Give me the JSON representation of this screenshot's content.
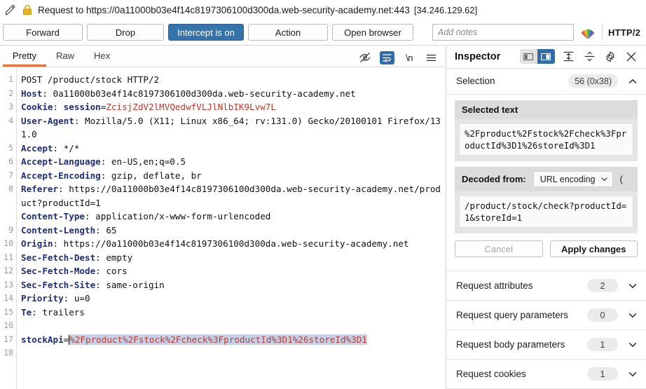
{
  "titlebar": {
    "edit_icon": "pencil-icon",
    "lock_icon": "lock-icon",
    "text": "Request to https://0a11000b03e4f14c8197306100d300da.web-security-academy.net:443",
    "ip": "[34.246.129.62]"
  },
  "actionbar": {
    "forward": "Forward",
    "drop": "Drop",
    "intercept": "Intercept is on",
    "action": "Action",
    "open_browser": "Open browser",
    "notes_placeholder": "Add notes",
    "notes_value": "",
    "logo_icon": "burp-logo-icon",
    "http_version": "HTTP/2",
    "accent_blue": "#3573ab"
  },
  "viewtabs": {
    "tabs": [
      {
        "label": "Pretty",
        "active": true
      },
      {
        "label": "Raw",
        "active": false
      },
      {
        "label": "Hex",
        "active": false
      }
    ],
    "active_underline_color": "#e8703a",
    "icons": [
      {
        "name": "eye-slash-icon",
        "active": false
      },
      {
        "name": "word-wrap-icon",
        "active": true
      },
      {
        "name": "show-newlines-icon",
        "active": false,
        "glyph": "\\n"
      },
      {
        "name": "hamburger-menu-icon",
        "active": false
      }
    ]
  },
  "request": {
    "line_numbers": [
      "1",
      "2",
      "3",
      "4",
      "",
      "5",
      "6",
      "7",
      "8",
      "",
      "",
      "9",
      "10",
      "11",
      "12",
      "13",
      "14",
      "15",
      "16",
      "17",
      "18"
    ],
    "lines": [
      {
        "n": 1,
        "parts": [
          {
            "t": "POST /product/stock HTTP/2",
            "c": "val"
          }
        ]
      },
      {
        "n": 2,
        "parts": [
          {
            "t": "Host",
            "c": "hdr"
          },
          {
            "t": ": 0a11000b03e4f14c8197306100d300da.web-security-academy.net",
            "c": "val"
          }
        ]
      },
      {
        "n": 3,
        "parts": [
          {
            "t": "Cookie",
            "c": "hdr"
          },
          {
            "t": ": ",
            "c": "val"
          },
          {
            "t": "session",
            "c": "hdr"
          },
          {
            "t": "=",
            "c": "val"
          },
          {
            "t": "ZcisjZdV2lMVQedwfVLJlNlbIK9Lvw7L",
            "c": "red"
          }
        ]
      },
      {
        "n": 4,
        "parts": [
          {
            "t": "User-Agent",
            "c": "hdr"
          },
          {
            "t": ": Mozilla/5.0 (X11; Linux x86_64; rv:131.0) Gecko/20100101 Firefox/131.0",
            "c": "val"
          }
        ]
      },
      {
        "n": 5,
        "parts": [
          {
            "t": "Accept",
            "c": "hdr"
          },
          {
            "t": ": */*",
            "c": "val"
          }
        ]
      },
      {
        "n": 6,
        "parts": [
          {
            "t": "Accept-Language",
            "c": "hdr"
          },
          {
            "t": ": en-US,en;q=0.5",
            "c": "val"
          }
        ]
      },
      {
        "n": 7,
        "parts": [
          {
            "t": "Accept-Encoding",
            "c": "hdr"
          },
          {
            "t": ": gzip, deflate, br",
            "c": "val"
          }
        ]
      },
      {
        "n": 8,
        "parts": [
          {
            "t": "Referer",
            "c": "hdr"
          },
          {
            "t": ": https://0a11000b03e4f14c8197306100d300da.web-security-academy.net/product?productId=1",
            "c": "val"
          }
        ]
      },
      {
        "n": 9,
        "parts": [
          {
            "t": "Content-Type",
            "c": "hdr"
          },
          {
            "t": ": application/x-www-form-urlencoded",
            "c": "val"
          }
        ]
      },
      {
        "n": 10,
        "parts": [
          {
            "t": "Content-Length",
            "c": "hdr"
          },
          {
            "t": ": 65",
            "c": "val"
          }
        ]
      },
      {
        "n": 11,
        "parts": [
          {
            "t": "Origin",
            "c": "hdr"
          },
          {
            "t": ": https://0a11000b03e4f14c8197306100d300da.web-security-academy.net",
            "c": "val"
          }
        ]
      },
      {
        "n": 12,
        "parts": [
          {
            "t": "Sec-Fetch-Dest",
            "c": "hdr"
          },
          {
            "t": ": empty",
            "c": "val"
          }
        ]
      },
      {
        "n": 13,
        "parts": [
          {
            "t": "Sec-Fetch-Mode",
            "c": "hdr"
          },
          {
            "t": ": cors",
            "c": "val"
          }
        ]
      },
      {
        "n": 14,
        "parts": [
          {
            "t": "Sec-Fetch-Site",
            "c": "hdr"
          },
          {
            "t": ": same-origin",
            "c": "val"
          }
        ]
      },
      {
        "n": 15,
        "parts": [
          {
            "t": "Priority",
            "c": "hdr"
          },
          {
            "t": ": u=0",
            "c": "val"
          }
        ]
      },
      {
        "n": 16,
        "parts": [
          {
            "t": "Te",
            "c": "hdr"
          },
          {
            "t": ": trailers",
            "c": "val"
          }
        ]
      },
      {
        "n": 17,
        "parts": [
          {
            "t": "",
            "c": "val"
          }
        ]
      },
      {
        "n": 18,
        "parts": [
          {
            "t": "stockApi",
            "c": "hdr"
          },
          {
            "t": "=",
            "c": "val"
          },
          {
            "t": "%2Fproduct%2Fstock%2Fcheck%3FproductId%3D1%26storeId%3D1",
            "c": "red sel"
          }
        ]
      }
    ],
    "selection_highlight_color": "#bfd3ec"
  },
  "inspector": {
    "title": "Inspector",
    "tools": [
      {
        "name": "layout-left-icon",
        "active": false
      },
      {
        "name": "layout-right-icon",
        "active": true
      },
      {
        "name": "expand-all-icon",
        "active": false
      },
      {
        "name": "collapse-all-icon",
        "active": false
      },
      {
        "name": "settings-gear-icon",
        "active": false
      },
      {
        "name": "close-icon",
        "active": false
      }
    ],
    "selection": {
      "label": "Selection",
      "count": "56 (0x38)",
      "chevron": "chevron-up-icon",
      "selected_text_label": "Selected text",
      "selected_text_value": "%2Fproduct%2Fstock%2Fcheck%3FproductId%3D1%26storeId%3D1",
      "decoded_from_label": "Decoded from:",
      "decoded_from_select": "URL encoding",
      "decoded_trailing": "(",
      "decoded_value": "/product/stock/check?productId=1&storeId=1",
      "cancel_label": "Cancel",
      "apply_label": "Apply changes"
    },
    "sections": [
      {
        "label": "Request attributes",
        "count": "2",
        "chevron": "chevron-down-icon"
      },
      {
        "label": "Request query parameters",
        "count": "0",
        "chevron": "chevron-down-icon"
      },
      {
        "label": "Request body parameters",
        "count": "1",
        "chevron": "chevron-down-icon"
      },
      {
        "label": "Request cookies",
        "count": "1",
        "chevron": "chevron-down-icon"
      }
    ]
  }
}
